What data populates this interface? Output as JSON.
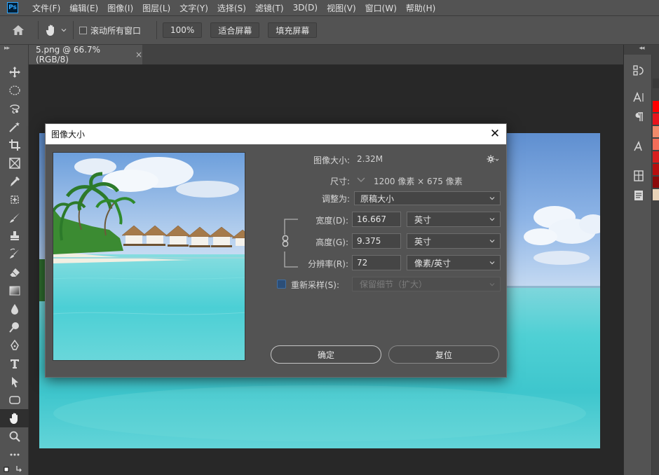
{
  "app": {
    "logo": "Ps",
    "menu": [
      "文件(F)",
      "编辑(E)",
      "图像(I)",
      "图层(L)",
      "文字(Y)",
      "选择(S)",
      "滤镜(T)",
      "3D(D)",
      "视图(V)",
      "窗口(W)",
      "帮助(H)"
    ]
  },
  "options": {
    "scroll_all_label": "滚动所有窗口",
    "zoom_100": "100%",
    "fit_screen": "适合屏幕",
    "fill_screen": "填充屏幕"
  },
  "toolbar": {
    "collapse": "▸▸",
    "tools": [
      "move-tool-icon",
      "marquee-tool-icon",
      "lasso-tool-icon",
      "magic-wand-tool-icon",
      "crop-tool-icon",
      "frame-tool-icon",
      "eyedropper-tool-icon",
      "healing-brush-tool-icon",
      "brush-tool-icon",
      "clone-stamp-tool-icon",
      "history-brush-tool-icon",
      "eraser-tool-icon",
      "gradient-tool-icon",
      "blur-tool-icon",
      "dodge-tool-icon",
      "pen-tool-icon",
      "type-tool-icon",
      "path-selection-tool-icon",
      "shape-tool-icon",
      "hand-tool-icon",
      "zoom-tool-icon",
      "more-tools-icon"
    ],
    "active_tool": "hand-tool-icon"
  },
  "document": {
    "tab_title": "5.png @ 66.7%(RGB/8)",
    "close": "×"
  },
  "right_panel": {
    "collapse": "◂◂",
    "swatch_colors": [
      "#ff0000",
      "#e8141c",
      "#f08a6a",
      "#f26e5a",
      "#d81e1e",
      "#b80f0f",
      "#8c0a0a",
      "#e8d3b8"
    ]
  },
  "dialog": {
    "title": "图像大小",
    "close": "✕",
    "image_size_label": "图像大小:",
    "image_size_value": "2.32M",
    "dimensions_label": "尺寸:",
    "dimensions_value": "1200 像素  ×  675 像素",
    "fit_to_label": "调整为:",
    "fit_to_value": "原稿大小",
    "width_label": "宽度(D):",
    "width_value": "16.667",
    "width_unit": "英寸",
    "height_label": "高度(G):",
    "height_value": "9.375",
    "height_unit": "英寸",
    "resolution_label": "分辨率(R):",
    "resolution_value": "72",
    "resolution_unit": "像素/英寸",
    "resample_label": "重新采样(S):",
    "resample_checked": false,
    "resample_method": "保留细节（扩大）",
    "ok_label": "确定",
    "reset_label": "复位"
  }
}
